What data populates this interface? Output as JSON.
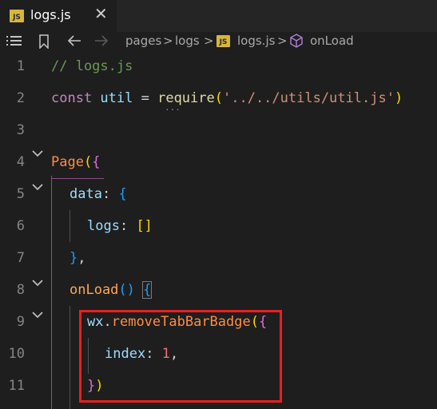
{
  "tab": {
    "badge": "JS",
    "label": "logs.js",
    "close": "✕"
  },
  "breadcrumb": {
    "items": [
      "pages",
      "logs",
      "logs.js",
      "onLoad"
    ],
    "sep": ">"
  },
  "lines": [
    {
      "n": "1"
    },
    {
      "n": "2"
    },
    {
      "n": "3"
    },
    {
      "n": "4"
    },
    {
      "n": "5"
    },
    {
      "n": "6"
    },
    {
      "n": "7"
    },
    {
      "n": "8"
    },
    {
      "n": "9"
    },
    {
      "n": "10"
    },
    {
      "n": "11"
    }
  ],
  "code": {
    "l1": "// logs.js",
    "l2_const": "const",
    "l2_util": " util ",
    "l2_eq": "= ",
    "l2_require": "require",
    "l2_open": "(",
    "l2_str": "'../../utils/util.js'",
    "l2_close": ")",
    "l4_page": "Page",
    "l4_paren": "(",
    "l4_brace": "{",
    "l5_data": "data",
    "l5_colon": ": ",
    "l5_brace": "{",
    "l6_logs": "logs",
    "l6_colon": ": ",
    "l6_arr": "[]",
    "l7_brace": "}",
    "l7_comma": ",",
    "l8_onload": "onLoad",
    "l8_parens": "() ",
    "l8_brace": "{",
    "l9_wx": "wx",
    "l9_dot": ".",
    "l9_func": "removeTabBarBadge",
    "l9_paren": "(",
    "l9_brace": "{",
    "l10_index": "index",
    "l10_colon": ": ",
    "l10_num": "1",
    "l10_comma": ",",
    "l11_brace": "}",
    "l11_paren": ")",
    "ellipsis": "···"
  },
  "highlight_color": "#e8201f"
}
